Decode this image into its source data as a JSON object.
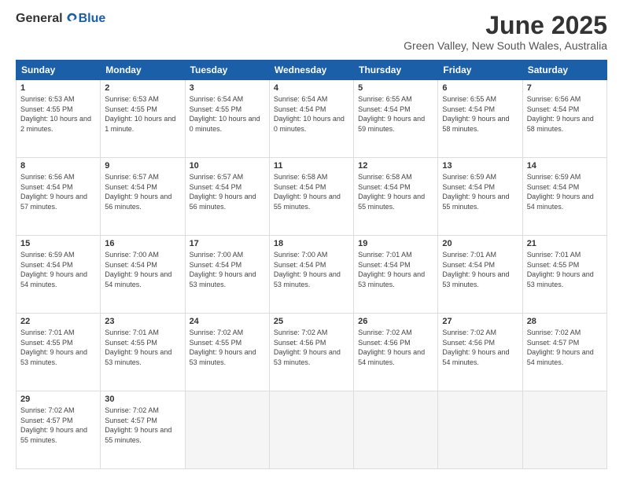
{
  "header": {
    "logo_general": "General",
    "logo_blue": "Blue",
    "month_title": "June 2025",
    "location": "Green Valley, New South Wales, Australia"
  },
  "weekdays": [
    "Sunday",
    "Monday",
    "Tuesday",
    "Wednesday",
    "Thursday",
    "Friday",
    "Saturday"
  ],
  "weeks": [
    [
      {
        "day": "1",
        "sunrise": "6:53 AM",
        "sunset": "4:55 PM",
        "daylight": "10 hours and 2 minutes."
      },
      {
        "day": "2",
        "sunrise": "6:53 AM",
        "sunset": "4:55 PM",
        "daylight": "10 hours and 1 minute."
      },
      {
        "day": "3",
        "sunrise": "6:54 AM",
        "sunset": "4:55 PM",
        "daylight": "10 hours and 0 minutes."
      },
      {
        "day": "4",
        "sunrise": "6:54 AM",
        "sunset": "4:54 PM",
        "daylight": "10 hours and 0 minutes."
      },
      {
        "day": "5",
        "sunrise": "6:55 AM",
        "sunset": "4:54 PM",
        "daylight": "9 hours and 59 minutes."
      },
      {
        "day": "6",
        "sunrise": "6:55 AM",
        "sunset": "4:54 PM",
        "daylight": "9 hours and 58 minutes."
      },
      {
        "day": "7",
        "sunrise": "6:56 AM",
        "sunset": "4:54 PM",
        "daylight": "9 hours and 58 minutes."
      }
    ],
    [
      {
        "day": "8",
        "sunrise": "6:56 AM",
        "sunset": "4:54 PM",
        "daylight": "9 hours and 57 minutes."
      },
      {
        "day": "9",
        "sunrise": "6:57 AM",
        "sunset": "4:54 PM",
        "daylight": "9 hours and 56 minutes."
      },
      {
        "day": "10",
        "sunrise": "6:57 AM",
        "sunset": "4:54 PM",
        "daylight": "9 hours and 56 minutes."
      },
      {
        "day": "11",
        "sunrise": "6:58 AM",
        "sunset": "4:54 PM",
        "daylight": "9 hours and 55 minutes."
      },
      {
        "day": "12",
        "sunrise": "6:58 AM",
        "sunset": "4:54 PM",
        "daylight": "9 hours and 55 minutes."
      },
      {
        "day": "13",
        "sunrise": "6:59 AM",
        "sunset": "4:54 PM",
        "daylight": "9 hours and 55 minutes."
      },
      {
        "day": "14",
        "sunrise": "6:59 AM",
        "sunset": "4:54 PM",
        "daylight": "9 hours and 54 minutes."
      }
    ],
    [
      {
        "day": "15",
        "sunrise": "6:59 AM",
        "sunset": "4:54 PM",
        "daylight": "9 hours and 54 minutes."
      },
      {
        "day": "16",
        "sunrise": "7:00 AM",
        "sunset": "4:54 PM",
        "daylight": "9 hours and 54 minutes."
      },
      {
        "day": "17",
        "sunrise": "7:00 AM",
        "sunset": "4:54 PM",
        "daylight": "9 hours and 53 minutes."
      },
      {
        "day": "18",
        "sunrise": "7:00 AM",
        "sunset": "4:54 PM",
        "daylight": "9 hours and 53 minutes."
      },
      {
        "day": "19",
        "sunrise": "7:01 AM",
        "sunset": "4:54 PM",
        "daylight": "9 hours and 53 minutes."
      },
      {
        "day": "20",
        "sunrise": "7:01 AM",
        "sunset": "4:54 PM",
        "daylight": "9 hours and 53 minutes."
      },
      {
        "day": "21",
        "sunrise": "7:01 AM",
        "sunset": "4:55 PM",
        "daylight": "9 hours and 53 minutes."
      }
    ],
    [
      {
        "day": "22",
        "sunrise": "7:01 AM",
        "sunset": "4:55 PM",
        "daylight": "9 hours and 53 minutes."
      },
      {
        "day": "23",
        "sunrise": "7:01 AM",
        "sunset": "4:55 PM",
        "daylight": "9 hours and 53 minutes."
      },
      {
        "day": "24",
        "sunrise": "7:02 AM",
        "sunset": "4:55 PM",
        "daylight": "9 hours and 53 minutes."
      },
      {
        "day": "25",
        "sunrise": "7:02 AM",
        "sunset": "4:56 PM",
        "daylight": "9 hours and 53 minutes."
      },
      {
        "day": "26",
        "sunrise": "7:02 AM",
        "sunset": "4:56 PM",
        "daylight": "9 hours and 54 minutes."
      },
      {
        "day": "27",
        "sunrise": "7:02 AM",
        "sunset": "4:56 PM",
        "daylight": "9 hours and 54 minutes."
      },
      {
        "day": "28",
        "sunrise": "7:02 AM",
        "sunset": "4:57 PM",
        "daylight": "9 hours and 54 minutes."
      }
    ],
    [
      {
        "day": "29",
        "sunrise": "7:02 AM",
        "sunset": "4:57 PM",
        "daylight": "9 hours and 55 minutes."
      },
      {
        "day": "30",
        "sunrise": "7:02 AM",
        "sunset": "4:57 PM",
        "daylight": "9 hours and 55 minutes."
      },
      null,
      null,
      null,
      null,
      null
    ]
  ],
  "labels": {
    "sunrise": "Sunrise: ",
    "sunset": "Sunset: ",
    "daylight": "Daylight: "
  }
}
